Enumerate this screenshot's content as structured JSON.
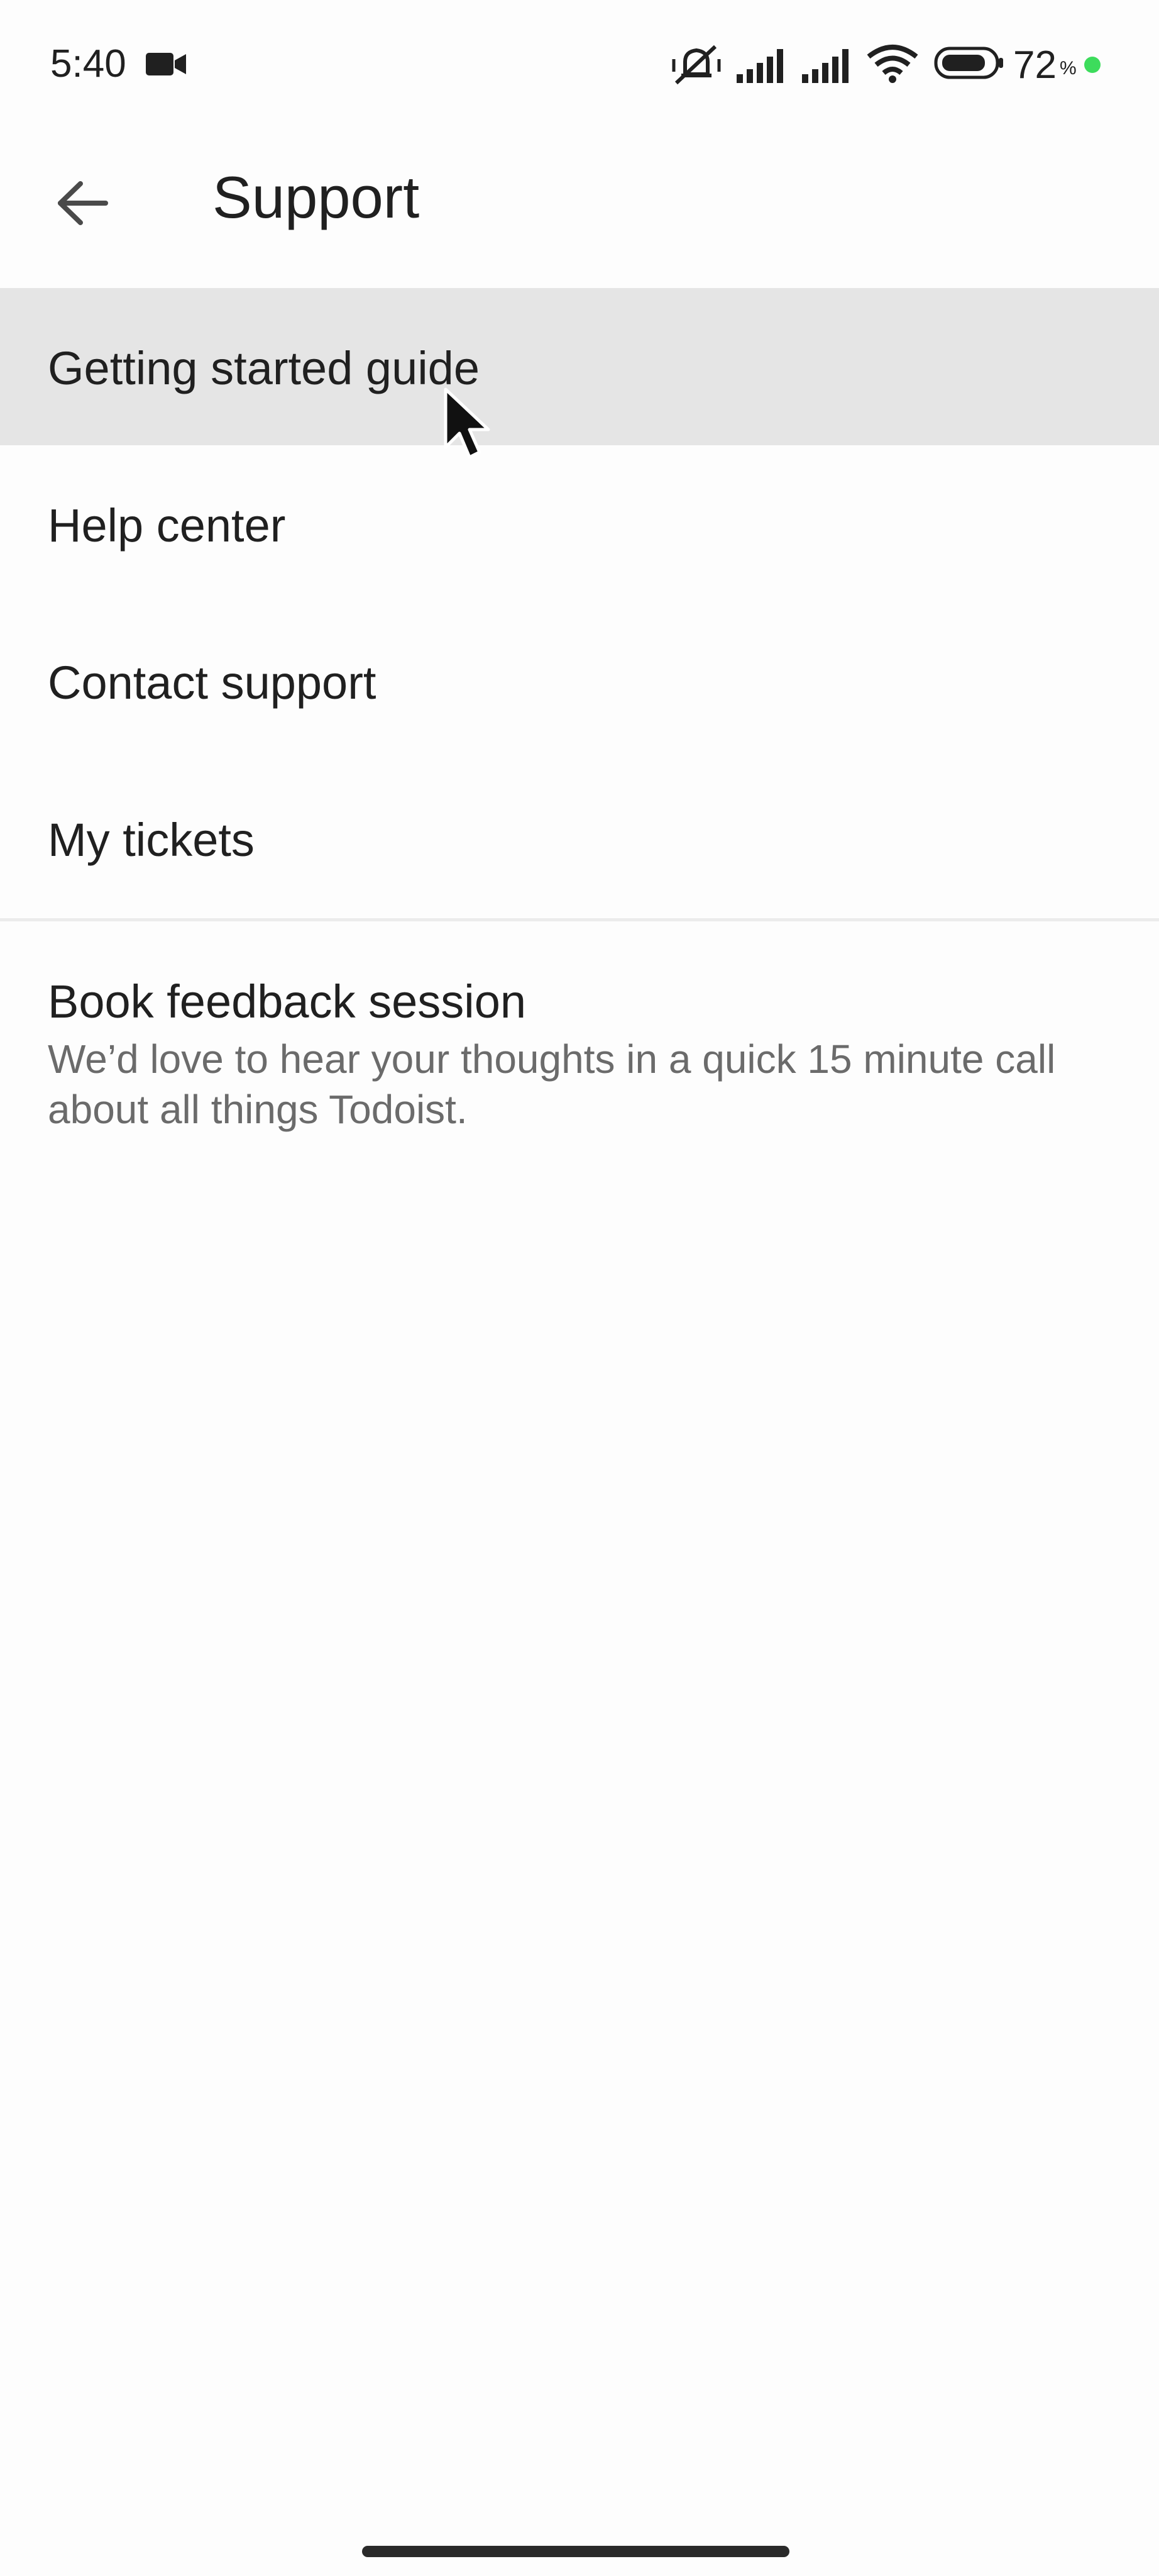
{
  "status_bar": {
    "time": "5:40",
    "battery_percent": "72",
    "percent_symbol": "%",
    "icons": [
      "video-camera-icon",
      "vibrate-off-icon",
      "signal-icon",
      "signal-icon",
      "wifi-icon",
      "battery-icon"
    ],
    "charging_dot_color": "#3ddc5c"
  },
  "app_bar": {
    "back_icon": "arrow-left-icon",
    "title": "Support"
  },
  "menu": {
    "items": [
      {
        "label": "Getting started guide",
        "selected": true
      },
      {
        "label": "Help center",
        "selected": false
      },
      {
        "label": "Contact support",
        "selected": false
      },
      {
        "label": "My tickets",
        "selected": false
      }
    ]
  },
  "feedback": {
    "title": "Book feedback session",
    "description": "We’d love to hear your thoughts in a quick 15 minute call about all things Todoist."
  },
  "colors": {
    "background": "#fdfdfd",
    "selected_row": "#e5e5e5",
    "text_primary": "#202020",
    "text_secondary": "#6b6b6b"
  }
}
